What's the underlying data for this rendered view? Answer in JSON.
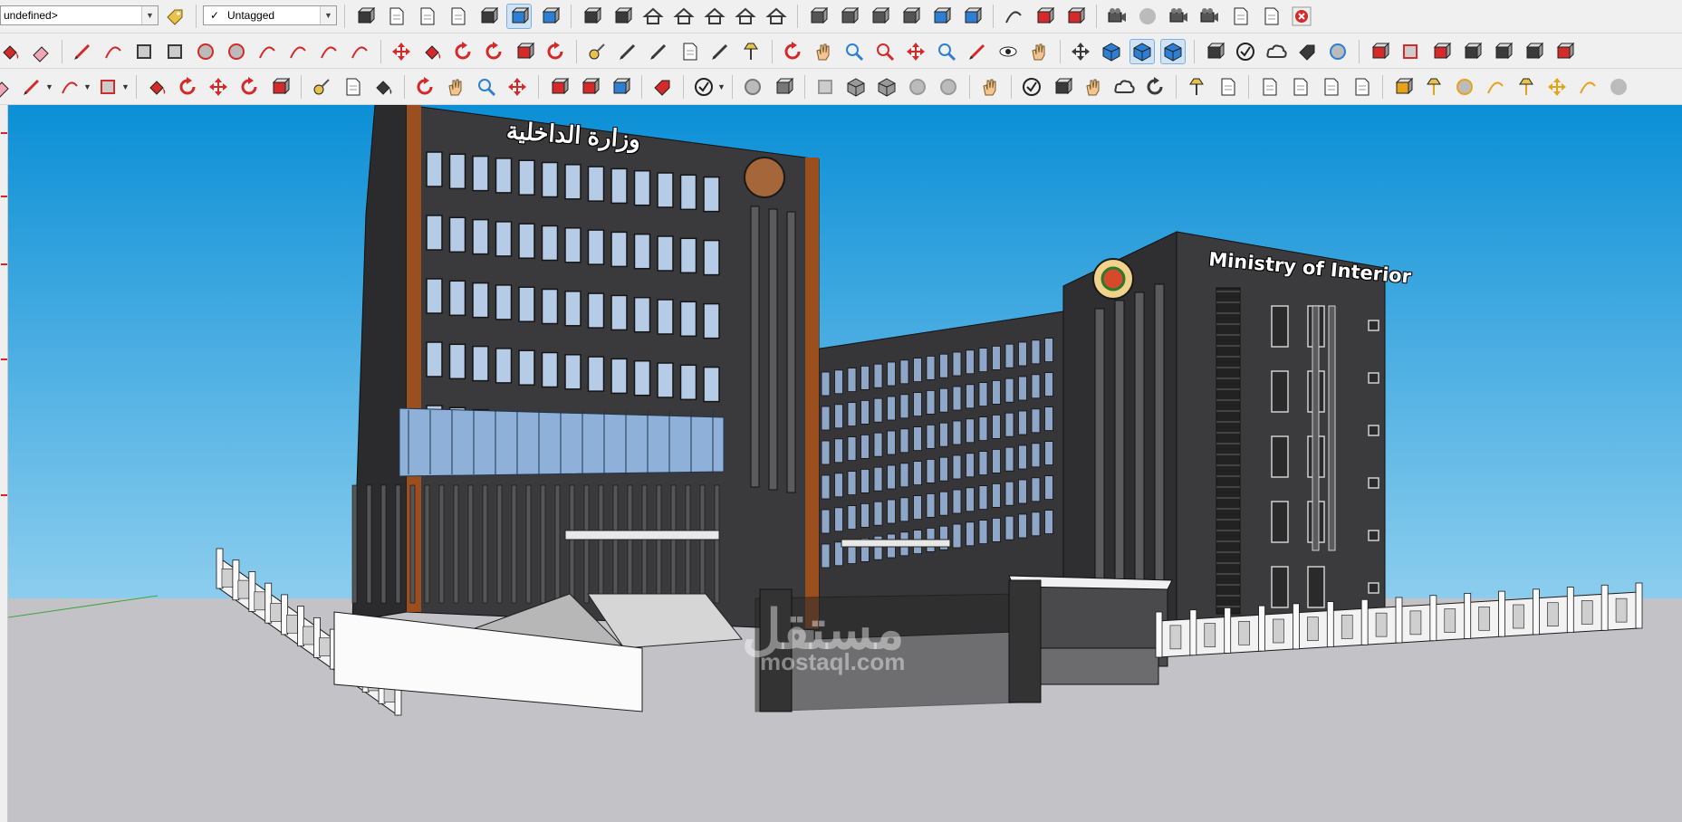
{
  "toolbar": {
    "scene_select": {
      "value": "undefined>"
    },
    "tag_select": {
      "check": "✓",
      "value": "Untagged"
    },
    "colors": {
      "accent_red": "#d42a2a",
      "accent_blue": "#2d7fd3",
      "icon_dark": "#3a3a3a"
    }
  },
  "viewport": {
    "sign_arabic": "وزارة الداخلية",
    "sign_english": "Ministry of Interior",
    "watermark_arabic": "مستقل",
    "watermark_url": "mostaql.com",
    "colors": {
      "sky_top": "#0f96d9",
      "sky_bottom": "#8fcdef",
      "ground": "#c3c3c7",
      "facade": "#3b3b3d",
      "accent_column": "#9b4f1f",
      "glass": "#8fb0d8"
    }
  }
}
